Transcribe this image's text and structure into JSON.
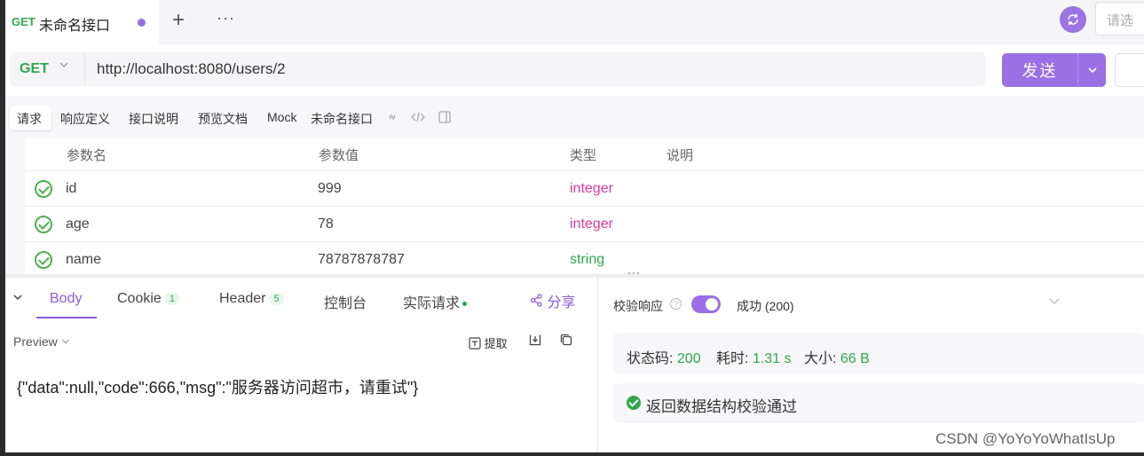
{
  "tab": {
    "method": "GET",
    "title": "未命名接口",
    "plus": "+",
    "more": "···"
  },
  "env": {
    "placeholder": "请选"
  },
  "request": {
    "method": "GET",
    "url": "http://localhost:8080/users/2",
    "send_label": "发送"
  },
  "subtabs": {
    "items": [
      "请求",
      "响应定义",
      "接口说明",
      "预览文档",
      "Mock"
    ],
    "name": "未命名接口"
  },
  "params": {
    "headers": {
      "name": "参数名",
      "value": "参数值",
      "type": "类型",
      "desc": "说明"
    },
    "rows": [
      {
        "name": "id",
        "value": "999",
        "type": "integer"
      },
      {
        "name": "age",
        "value": "78",
        "type": "integer"
      },
      {
        "name": "name",
        "value": "78787878787",
        "type": "string"
      }
    ]
  },
  "response": {
    "tabs": {
      "body": "Body",
      "cookie": "Cookie",
      "cookie_count": "1",
      "header": "Header",
      "header_count": "5",
      "console": "控制台",
      "actual": "实际请求"
    },
    "share": "分享",
    "preview": "Preview",
    "extract": "提取",
    "body": "{\"data\":null,\"code\":666,\"msg\":\"服务器访问超市，请重试\"}"
  },
  "verify": {
    "label": "校验响应",
    "result": "成功 (200)",
    "status_label": "状态码:",
    "status_value": "200",
    "time_label": "耗时:",
    "time_value": "1.31 s",
    "size_label": "大小:",
    "size_value": "66 B",
    "schema_message": "返回数据结构校验通过"
  },
  "watermark": "CSDN @YoYoYoWhatIsUp",
  "colors": {
    "accent": "#9a70e4",
    "success": "#2fa84f",
    "integer": "#d63aa0"
  }
}
